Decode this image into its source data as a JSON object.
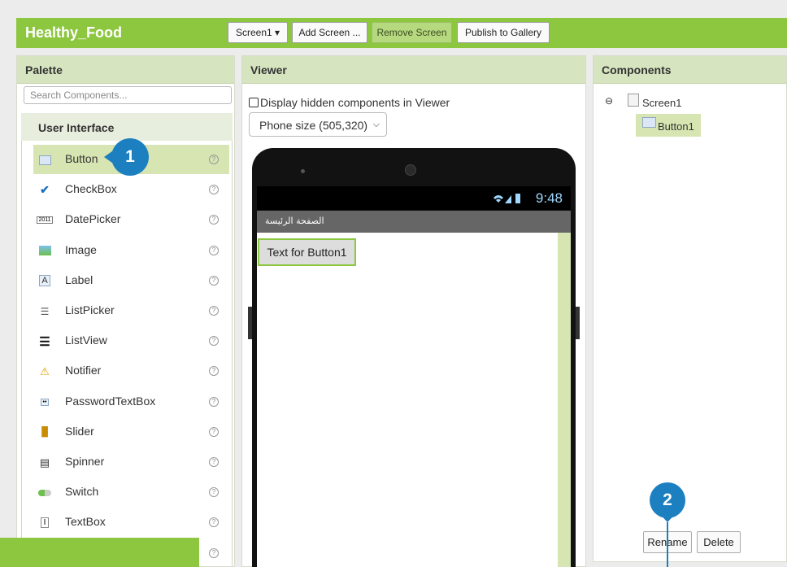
{
  "app_title": "Healthy_Food",
  "toolbar": {
    "screen_select": "Screen1 ▾",
    "add_screen": "Add Screen ...",
    "remove_screen": "Remove Screen",
    "publish": "Publish to Gallery"
  },
  "palette": {
    "title": "Palette",
    "search_placeholder": "Search Components...",
    "section": "User Interface",
    "items": [
      {
        "label": "Button",
        "icon": "button-icon"
      },
      {
        "label": "CheckBox",
        "icon": "checkbox-icon"
      },
      {
        "label": "DatePicker",
        "icon": "datepicker-icon"
      },
      {
        "label": "Image",
        "icon": "image-icon"
      },
      {
        "label": "Label",
        "icon": "label-icon"
      },
      {
        "label": "ListPicker",
        "icon": "listpicker-icon"
      },
      {
        "label": "ListView",
        "icon": "listview-icon"
      },
      {
        "label": "Notifier",
        "icon": "notifier-icon"
      },
      {
        "label": "PasswordTextBox",
        "icon": "password-icon"
      },
      {
        "label": "Slider",
        "icon": "slider-icon"
      },
      {
        "label": "Spinner",
        "icon": "spinner-icon"
      },
      {
        "label": "Switch",
        "icon": "switch-icon"
      },
      {
        "label": "TextBox",
        "icon": "textbox-icon"
      }
    ],
    "help_glyph": "?"
  },
  "viewer": {
    "title": "Viewer",
    "hidden_checkbox_label": "Display hidden components in Viewer",
    "size_select": "Phone size (505,320)",
    "clock": "9:48",
    "screen_title": "الصفحة الرئيسة",
    "button_text": "Text for Button1"
  },
  "components": {
    "title": "Components",
    "tree_toggle": "⊖",
    "screen": "Screen1",
    "button": "Button1",
    "rename": "Rename",
    "delete": "Delete"
  },
  "callouts": {
    "one": "1",
    "two": "2"
  },
  "colors": {
    "brand_green": "#8dc63f",
    "callout_blue": "#1b7fc0"
  }
}
